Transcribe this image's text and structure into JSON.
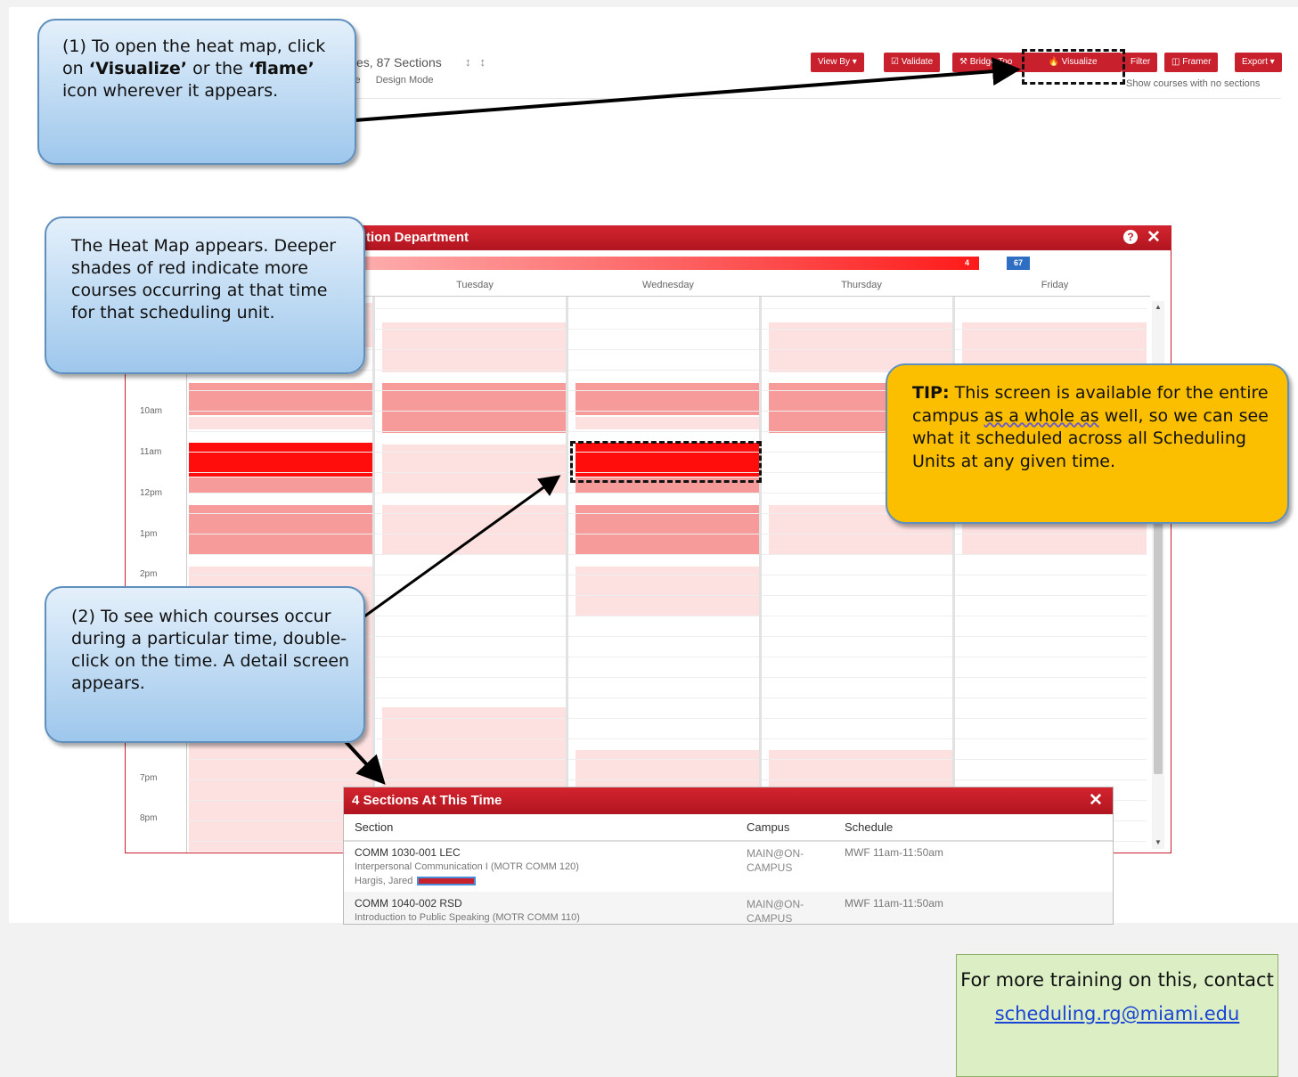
{
  "toolbar": {
    "title_fragment": "ses, 87 Sections",
    "sub_links": [
      "se",
      "Design Mode"
    ],
    "buttons": {
      "view_by": "View By ▾",
      "validate": "☑ Validate",
      "bridge_tools": "⚒ Bridge Too",
      "visualize": "🔥 Visualize",
      "filter": "Filter",
      "framer": "◫ Framer",
      "export": "Export ▾"
    },
    "no_sections_note": "Show courses with no sections"
  },
  "heatmap": {
    "title": "tion Department",
    "legend_max": "4",
    "legend_total": "67",
    "days": [
      "Tuesday",
      "Wednesday",
      "Thursday",
      "Friday"
    ],
    "times": [
      "10am",
      "11am",
      "12pm",
      "1pm",
      "2pm",
      "7pm",
      "8pm"
    ],
    "colors": {
      "light": "#fde0e0",
      "medium": "#f79a9a",
      "heavy": "#ff0d0d",
      "header": "#c9202d"
    }
  },
  "detail": {
    "title": "4 Sections At This Time",
    "columns": {
      "section": "Section",
      "campus": "Campus",
      "schedule": "Schedule"
    },
    "rows": [
      {
        "code": "COMM 1030-001 LEC",
        "course": "Interpersonal Communication I (MOTR COMM 120)",
        "instructor": "Hargis, Jared",
        "campus": "MAIN@ON-CAMPUS",
        "schedule": "MWF 11am-11:50am"
      },
      {
        "code": "COMM 1040-002 RSD",
        "course": "Introduction to Public Speaking (MOTR COMM 110)",
        "instructor": "",
        "campus": "MAIN@ON-CAMPUS",
        "schedule": "MWF 11am-11:50am"
      }
    ]
  },
  "callouts": {
    "step1": {
      "a": "(1) To open the heat map, click on ",
      "b": "‘Visualize’",
      "c": " or the ",
      "d": "‘flame’",
      "e": " icon wherever it appears."
    },
    "heat_map": "The Heat Map appears. Deeper shades of red indicate more courses occurring at that time for that scheduling unit.",
    "step2": "(2) To see which courses occur during a particular time, double-click on the time.  A detail screen appears.",
    "tip": {
      "label": "TIP:",
      "a": " This screen is available for the entire campus ",
      "b": "as a whole as",
      "c": " well, so we can see what it scheduled across all Scheduling Units at any given time."
    }
  },
  "training": {
    "text": "For more training on this, contact",
    "email": "scheduling.rg@miami.edu"
  }
}
